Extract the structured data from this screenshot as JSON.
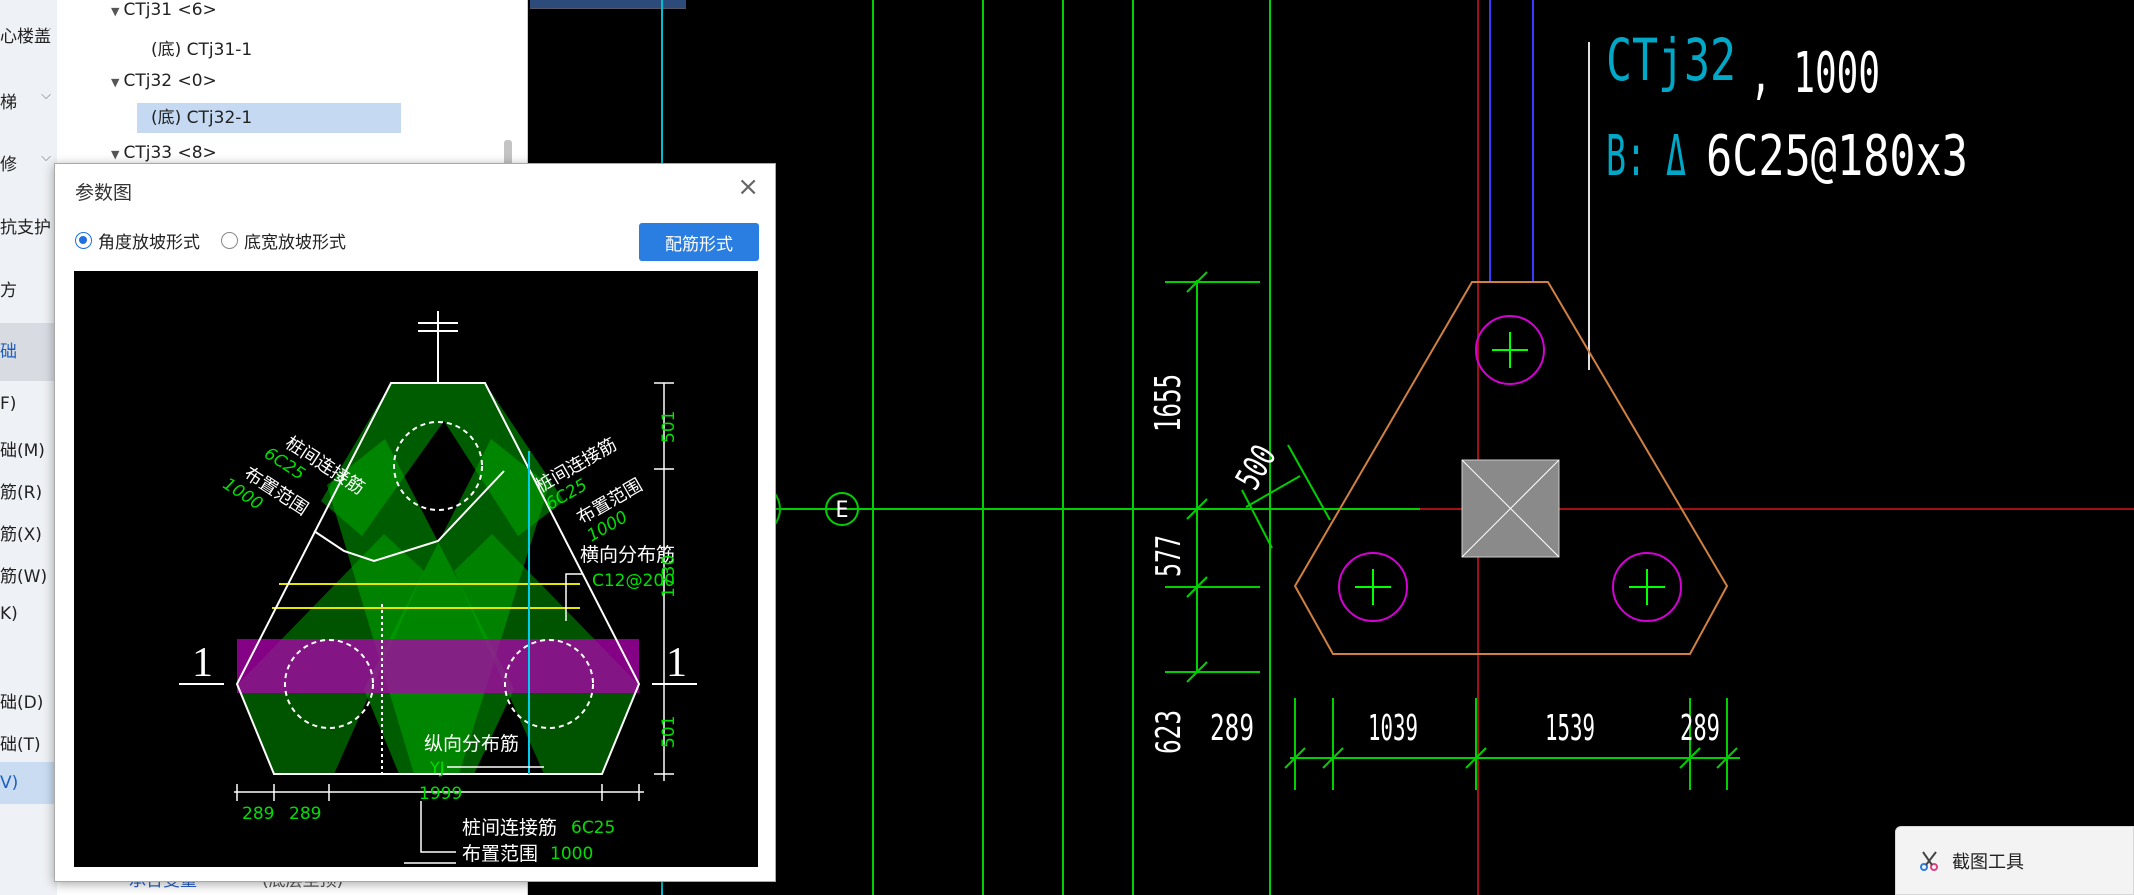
{
  "sidebar": {
    "items": [
      "心楼盖",
      "梯",
      "修",
      "抗支护",
      "方",
      "础",
      "F)",
      "础(M)",
      "筋(R)",
      "筋(X)",
      "筋(W)",
      "K)",
      "础(D)",
      "础(T)",
      "V)"
    ]
  },
  "tree": {
    "rows": [
      {
        "label": "CTj31 <6>",
        "kind": "parent"
      },
      {
        "label": "(底) CTj31-1",
        "kind": "child"
      },
      {
        "label": "CTj32 <0>",
        "kind": "parent"
      },
      {
        "label": "(底) CTj32-1",
        "kind": "child",
        "selected": true
      },
      {
        "label": "CTj33 <8>",
        "kind": "parent"
      }
    ],
    "bottom_stub": {
      "left": "承台变量",
      "right": "(底层至顶)"
    }
  },
  "dialog": {
    "title": "参数图",
    "close": "×",
    "radio_angle": "角度放坡形式",
    "radio_width": "底宽放坡形式",
    "radio_selected": "角度放坡形式",
    "button": "配筋形式",
    "drawing": {
      "section_mark": "1",
      "left_label_1": "桩间连接筋",
      "left_value_1": "6C25",
      "left_label_2": "布置范围",
      "left_value_2": "1000",
      "right_label_1": "桩间连接筋",
      "right_value_1": "6C25",
      "right_label_2": "布置范围",
      "right_value_2": "1000",
      "transverse_label": "横向分布筋",
      "transverse_value": "C12@200",
      "longitudinal_label": "纵向分布筋",
      "longitudinal_value": "YJ",
      "bottom_label_1": "桩间连接筋",
      "bottom_value_1": "6C25",
      "bottom_label_2": "布置范围",
      "bottom_value_2": "1000",
      "dim_501_top": "501",
      "dim_1730": "1730",
      "dim_501_bottom": "501",
      "dim_1999": "1999",
      "dim_289_a": "289",
      "dim_289_b": "289"
    }
  },
  "cad": {
    "name": "CTj32",
    "name_suffix": ", 1000",
    "rebar_prefix": "B: Δ",
    "rebar_spec": "6C25@180x3",
    "axis_label": "E",
    "dim_1655": "1655",
    "dim_500": "500",
    "dim_577": "577",
    "dim_623": "623",
    "dim_289_left": "289",
    "dim_1039": "1039",
    "dim_1539": "1539",
    "dim_289_right": "289"
  },
  "snip_tool": {
    "label": "截图工具"
  },
  "colors": {
    "accent": "#2a7de1",
    "cad_green": "#00ff00",
    "cad_cyan": "#00a0c0",
    "cad_outline": "#d08040",
    "cad_pile": "#d400d4",
    "cad_axis_red": "#a01010",
    "cad_blue": "#2222ff"
  }
}
